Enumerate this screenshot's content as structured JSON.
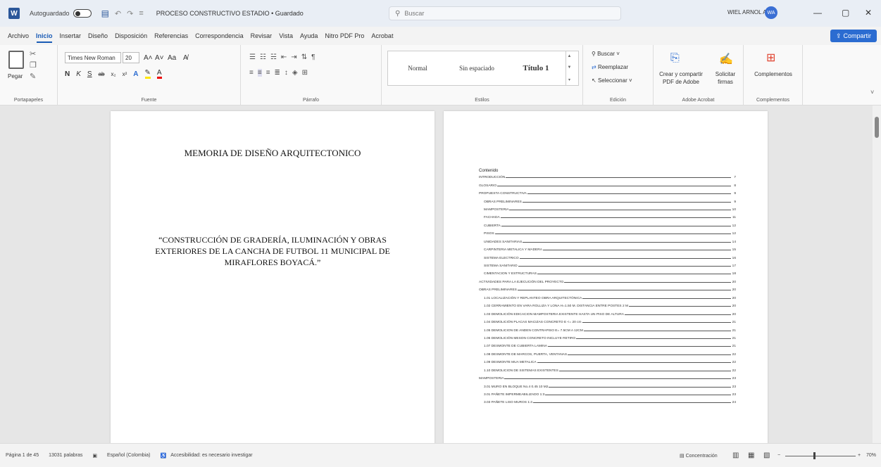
{
  "titlebar": {
    "autosave_label": "Autoguardado",
    "document_title": "PROCESO CONSTRUCTIVO ESTADIO • Guardado",
    "search_placeholder": "Buscar",
    "user_name": "WIEL ARNOL ALBA",
    "user_initials": "WA"
  },
  "menu": {
    "tabs": [
      "Archivo",
      "Inicio",
      "Insertar",
      "Diseño",
      "Disposición",
      "Referencias",
      "Correspondencia",
      "Revisar",
      "Vista",
      "Ayuda",
      "Nitro PDF Pro",
      "Acrobat"
    ],
    "share_label": "Compartir"
  },
  "ribbon": {
    "clipboard": {
      "paste_label": "Pegar",
      "group_label": "Portapapeles"
    },
    "font": {
      "name": "Times New Roman",
      "size": "20",
      "group_label": "Fuente"
    },
    "paragraph": {
      "group_label": "Párrafo"
    },
    "styles": {
      "items": [
        "Normal",
        "Sin espaciado",
        "Título 1"
      ],
      "group_label": "Estilos"
    },
    "editing": {
      "find": "Buscar",
      "replace": "Reemplazar",
      "select": "Seleccionar",
      "group_label": "Edición"
    },
    "acrobat": {
      "create_share": "Crear y compartir PDF de Adobe",
      "request_sign": "Solicitar firmas",
      "group_label": "Adobe Acrobat"
    },
    "addins": {
      "label": "Complementos",
      "group_label": "Complementos"
    }
  },
  "page1": {
    "title": "MEMORIA DE DISEÑO ARQUITECTONICO",
    "project": "“CONSTRUCCIÓN DE GRADERÍA, ILUMINACIÓN Y OBRAS EXTERIORES DE LA CANCHA DE FUTBOL 11 MUNICIPAL DE MIRAFLORES BOYACÁ.”"
  },
  "toc": {
    "heading": "Contenido",
    "entries": [
      {
        "text": "INTRODUCCIÓN",
        "page": "7",
        "level": 0
      },
      {
        "text": "GLOSARIO",
        "page": "8",
        "level": 0
      },
      {
        "text": "PROPUESTA CONSTRUCTIVA",
        "page": "9",
        "level": 0
      },
      {
        "text": "OBRAS PRELIMINARES",
        "page": "9",
        "level": 1
      },
      {
        "text": "MAMPOSTERIA",
        "page": "10",
        "level": 1
      },
      {
        "text": "FACHADA",
        "page": "11",
        "level": 1
      },
      {
        "text": "CUBIERTA",
        "page": "12",
        "level": 1
      },
      {
        "text": "PISOS",
        "page": "12",
        "level": 1
      },
      {
        "text": "UNIDADES SANITARIAS",
        "page": "14",
        "level": 1
      },
      {
        "text": "CARPINTERIA METALICA Y MADERA",
        "page": "15",
        "level": 1
      },
      {
        "text": "SISTEMA ELECTRICO",
        "page": "16",
        "level": 1
      },
      {
        "text": "SISTEMA SANITARIO",
        "page": "17",
        "level": 1
      },
      {
        "text": "CIMENTACION Y ESTRUCTURAS",
        "page": "18",
        "level": 1
      },
      {
        "text": "ACTIVIDADES PARA LA EJECUCIÓN DEL PROYECTO",
        "page": "20",
        "level": 0
      },
      {
        "text": "OBRAS PRELIMINARES",
        "page": "20",
        "level": 0
      },
      {
        "text": "1.01 LOCALIZACIÓN Y REPLANTEO OBRA ARQUITECTÓNICA",
        "page": "20",
        "level": 1
      },
      {
        "text": "1.02 CERRAMIENTO EN VARA ROLLIZA Y LONA H=1.50 M. DISTANCIA ENTRE POSTES 2 M",
        "page": "20",
        "level": 1
      },
      {
        "text": "1.03 DEMOLICIÓN EDICACION MAMPOSTERIA EXISTENTE HASTA UN PISO DE ALTURA",
        "page": "20",
        "level": 1
      },
      {
        "text": "1.04 DEMOLICIÓN PLACAS MACIZAS CONCRETO E <= 20 cm",
        "page": "21",
        "level": 1
      },
      {
        "text": "1.05 DEMOLICION DE ANDEN CONTRAPISO E= 7.5CM A 12CM",
        "page": "21",
        "level": 1
      },
      {
        "text": "1.06 DEMOLICIÓN MESON CONCRETO INCLUYE RETIRO",
        "page": "21",
        "level": 1
      },
      {
        "text": "1.07 DESMONTE DE CUBIERTA LAMINA",
        "page": "21",
        "level": 1
      },
      {
        "text": "1.08 DESMONTE DE MARCOS, PUERTA, VENTANAS",
        "page": "22",
        "level": 1
      },
      {
        "text": "1.09 DESMONTE MUA METALICA",
        "page": "22",
        "level": 1
      },
      {
        "text": "1.10 DEMOLICION DE SISTEMAS EXISTENTES",
        "page": "22",
        "level": 1
      },
      {
        "text": "MAMPOSTERIA",
        "page": "23",
        "level": 0
      },
      {
        "text": "3.01 MURO EN BLOQUE No.4 0.45 10 M2",
        "page": "23",
        "level": 1
      },
      {
        "text": "3.01 PAÑETE IMPERMEABILIZADO 1:3",
        "page": "23",
        "level": 1
      },
      {
        "text": "3.03 PAÑETE LISO MUROS 1:4",
        "page": "24",
        "level": 1
      }
    ]
  },
  "status": {
    "page": "Página 1 de 45",
    "words": "13031 palabras",
    "language": "Español (Colombia)",
    "accessibility": "Accesibilidad: es necesario investigar",
    "focus": "Concentración",
    "zoom": "70%"
  }
}
